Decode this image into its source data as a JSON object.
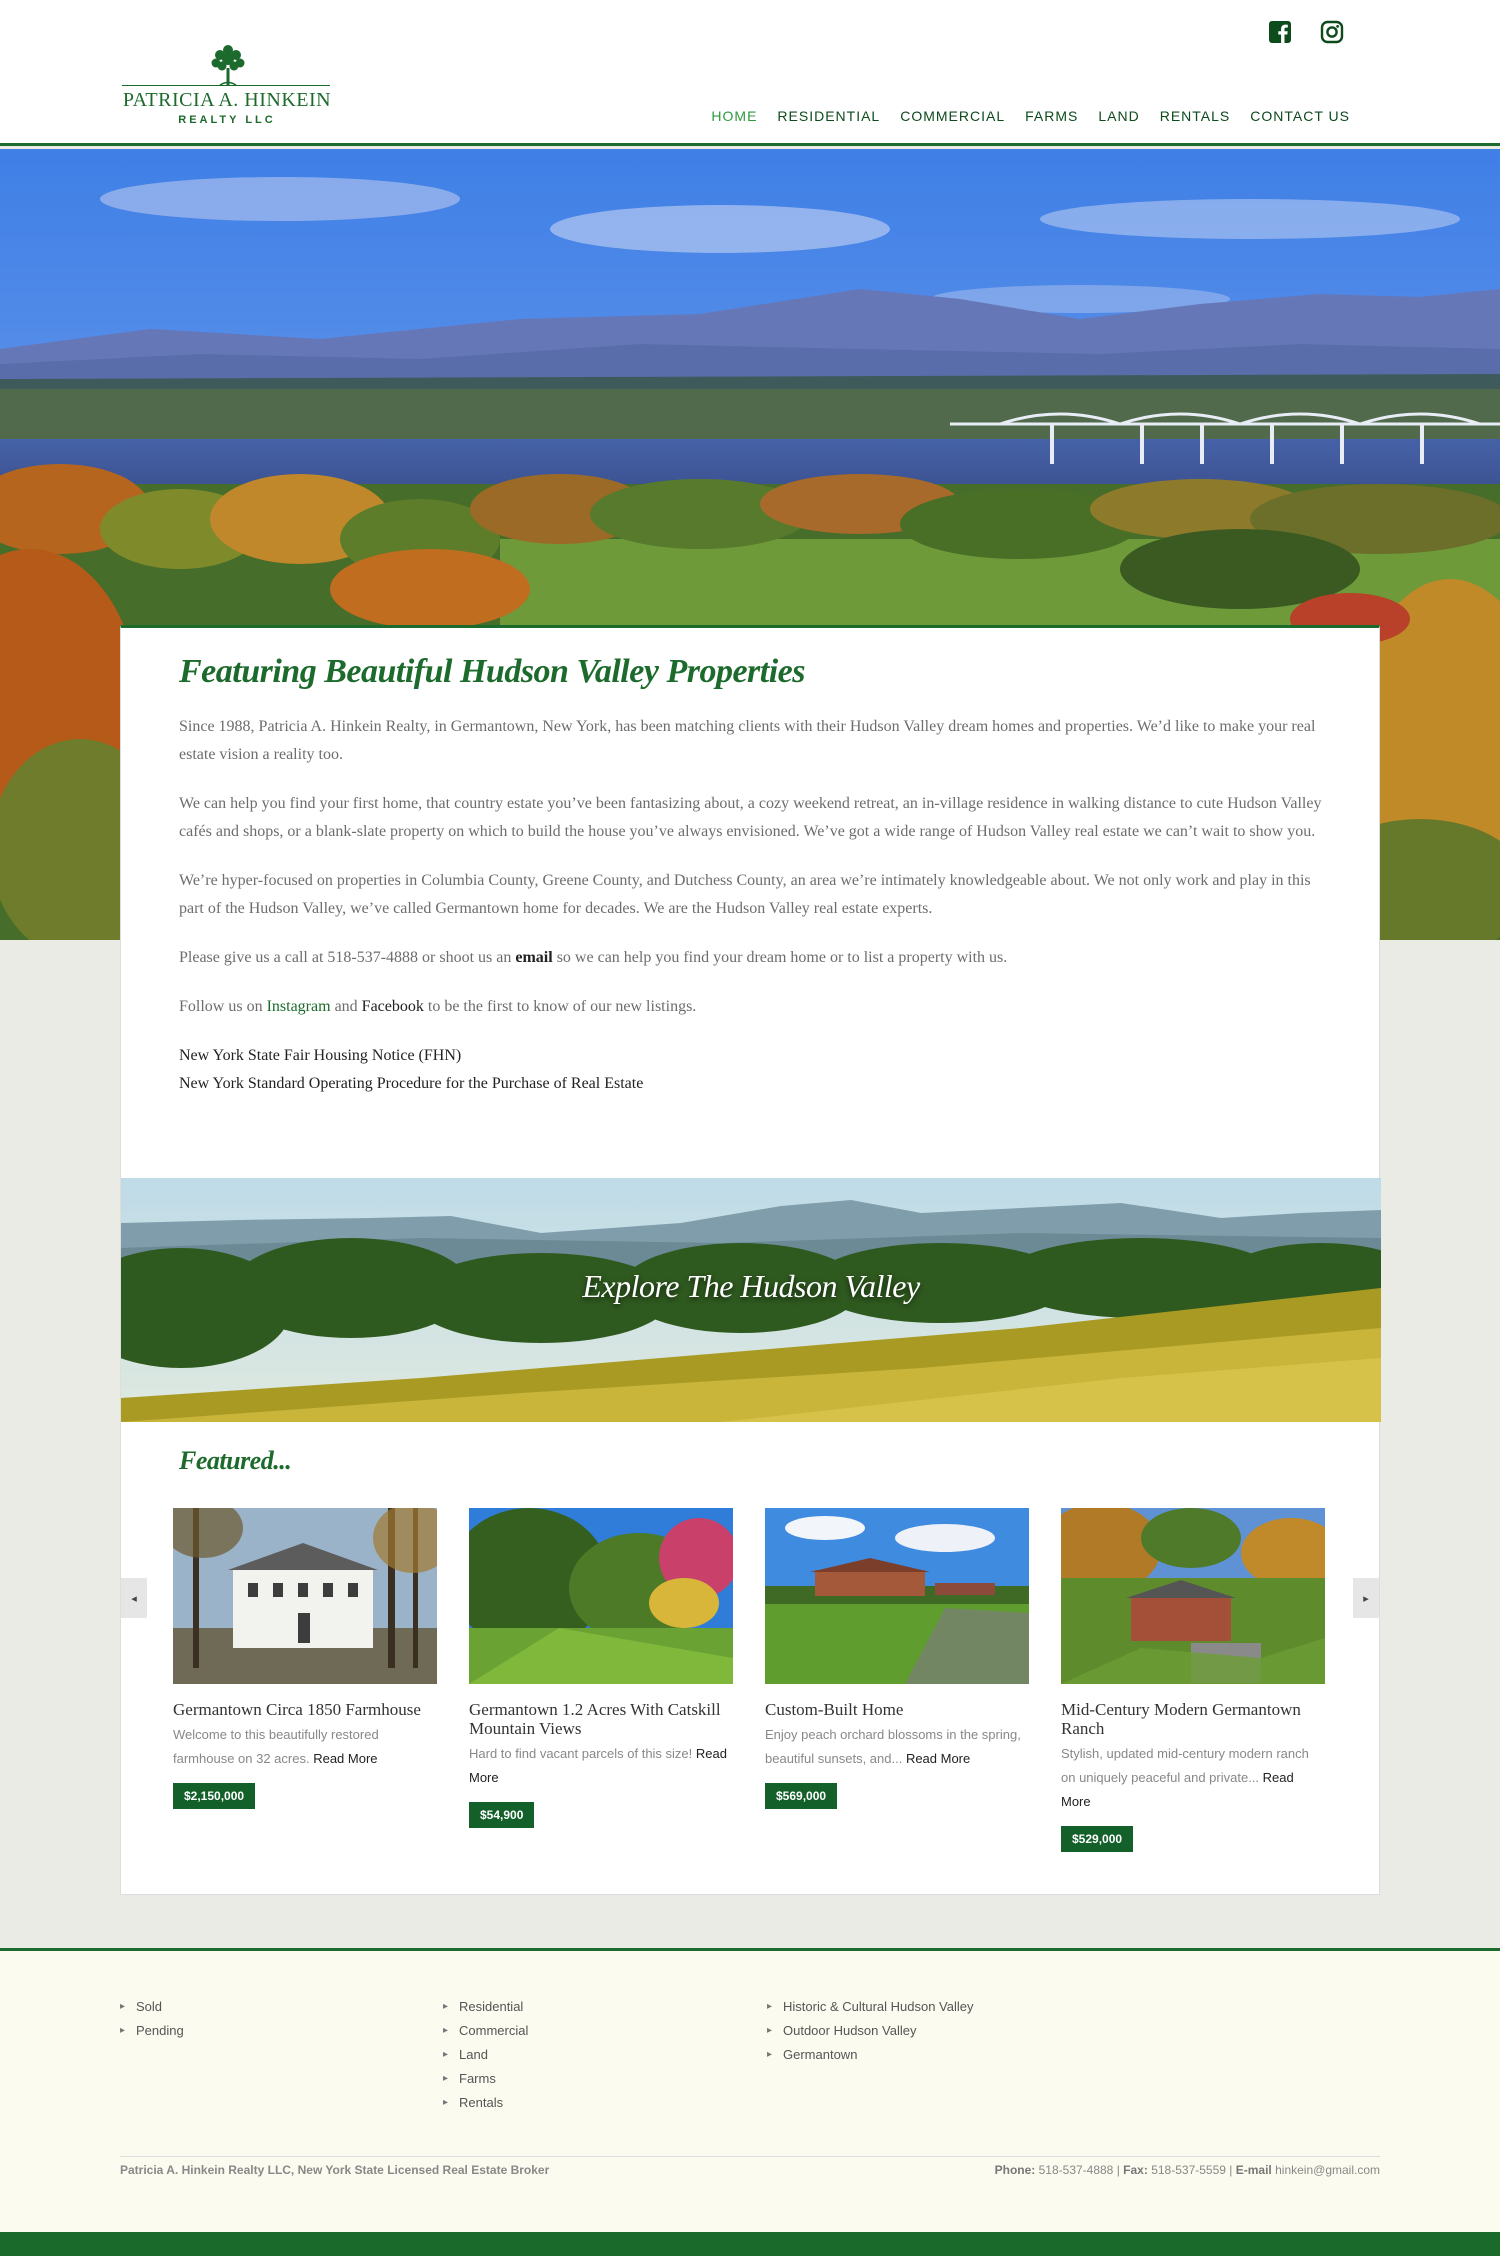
{
  "site": {
    "logo_name": "PATRICIA A. HINKEIN",
    "logo_sub": "REALTY LLC"
  },
  "social": {
    "facebook_icon": "facebook-icon",
    "instagram_icon": "instagram-icon"
  },
  "nav": {
    "items": [
      "HOME",
      "RESIDENTIAL",
      "COMMERCIAL",
      "FARMS",
      "LAND",
      "RENTALS",
      "CONTACT US"
    ],
    "active": "HOME"
  },
  "intro": {
    "heading": "Featuring Beautiful Hudson Valley Properties",
    "p1": "Since 1988, Patricia A. Hinkein Realty, in Germantown, New York, has been matching clients with their Hudson Valley dream homes and properties. We’d like to make your real estate vision a reality too.",
    "p2": "We can help you find your first home, that country estate you’ve been fantasizing about, a cozy weekend retreat, an in-village residence in walking distance to cute Hudson Valley cafés and shops, or a blank-slate property on which to build the house you’ve always envisioned. We’ve got a wide range of Hudson Valley real estate we can’t wait to show you.",
    "p3": "We’re hyper-focused on properties in Columbia County, Greene County, and Dutchess County, an area we’re intimately knowledgeable about. We not only work and play in this part of the Hudson Valley, we’ve called Germantown home for decades. We are the Hudson Valley real estate experts.",
    "p4_a": "Please give us a call at 518-537-4888 or shoot us an ",
    "p4_email": "email",
    "p4_b": " so we can help you find your dream home or to list a property with us.",
    "p5_a": "Follow us on ",
    "p5_instagram": "Instagram",
    "p5_and": " and ",
    "p5_facebook": "Facebook",
    "p5_b": " to be the first to know of our new listings.",
    "link_fhn": "New York State Fair Housing Notice (FHN)",
    "link_sop": "New York Standard Operating Procedure for the Purchase of Real Estate"
  },
  "explore": {
    "title": "Explore The Hudson Valley"
  },
  "featured": {
    "title": "Featured...",
    "prev": "◂",
    "next": "▸",
    "listings": [
      {
        "title": "Germantown Circa 1850 Farmhouse",
        "desc": "Welcome to this beautifully restored farmhouse on 32 acres.",
        "more": "Read More",
        "price": "$2,150,000"
      },
      {
        "title": "Germantown 1.2 Acres With Catskill Mountain Views",
        "desc": "Hard to find vacant parcels of this size!",
        "more": "Read More",
        "price": "$54,900"
      },
      {
        "title": "Custom-Built Home",
        "desc": "Enjoy peach orchard blossoms in the spring, beautiful sunsets, and...",
        "more": "Read More",
        "price": "$569,000"
      },
      {
        "title": "Mid-Century Modern Germantown Ranch",
        "desc": "Stylish, updated mid-century modern ranch on uniquely peaceful and private...",
        "more": "Read More",
        "price": "$529,000"
      }
    ]
  },
  "footer": {
    "col1": [
      "Sold",
      "Pending"
    ],
    "col2": [
      "Residential",
      "Commercial",
      "Land",
      "Farms",
      "Rentals"
    ],
    "col3": [
      "Historic & Cultural Hudson Valley",
      "Outdoor Hudson Valley",
      "Germantown"
    ],
    "broker": "Patricia A. Hinkein Realty LLC, New York State Licensed Real Estate Broker",
    "phone_label": "Phone:",
    "phone": "518-537-4888",
    "fax_label": "Fax:",
    "fax": "518-537-5559",
    "email_label": "E-mail",
    "email": "hinkein@gmail.com",
    "sep": "|"
  },
  "colors": {
    "brand_green": "#1c6a2c",
    "price_badge": "#14602a",
    "nav_active": "#2f9a3f",
    "footer_bg": "#fbfbef",
    "page_bg": "#ebebe5"
  }
}
